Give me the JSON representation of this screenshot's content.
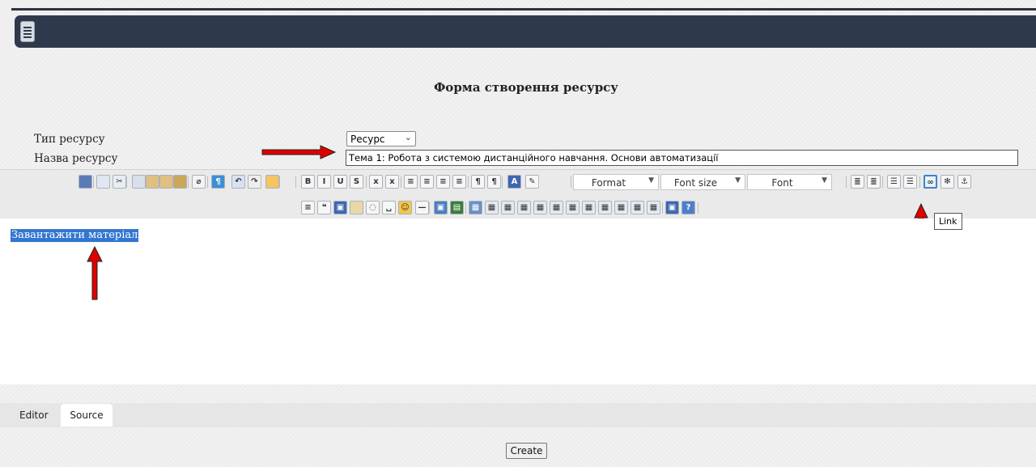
{
  "page": {
    "form_title": "Форма створення ресурсу"
  },
  "form": {
    "type_label": "Тип ресурсу",
    "type_value": "Ресурс",
    "name_label": "Назва ресурсу",
    "name_value": "Тема 1: Робота з системою дистанційного навчання. Основи автоматизації"
  },
  "toolbar": {
    "format_label": "Format",
    "font_size_label": "Font size",
    "font_label": "Font",
    "row1_icons": [
      "save-icon",
      "new-page-icon",
      "cut-icon",
      "copy-icon",
      "paste-icon",
      "paste-text-icon",
      "paste-word-icon",
      "remove-format-icon",
      "show-blocks-icon",
      "undo-icon",
      "redo-icon",
      "image-browser-icon",
      "bold-icon",
      "italic-icon",
      "underline-icon",
      "strike-icon",
      "subscript-icon",
      "superscript-icon",
      "align-left-icon",
      "align-center-icon",
      "align-right-icon",
      "justify-icon",
      "ltr-icon",
      "rtl-icon",
      "text-color-icon",
      "spellcheck-icon",
      "outdent-icon",
      "indent-icon",
      "numbered-list-icon",
      "bulleted-list-icon",
      "link-icon",
      "unlink-icon",
      "anchor-icon"
    ],
    "row2_icons": [
      "div-icon",
      "blockquote-icon",
      "maximize-icon",
      "template-icon",
      "flash-icon",
      "nbsp-icon",
      "smiley-icon",
      "horizontal-rule-icon",
      "image-icon",
      "media-icon",
      "table-icon",
      "table-props-icon",
      "delete-table-icon",
      "insert-row-icon",
      "delete-row-icon",
      "insert-col-icon",
      "delete-col-icon",
      "merge-cells-icon",
      "split-cells-icon",
      "cell-props-icon",
      "insert-cell-icon",
      "delete-cell-icon",
      "fullscreen-icon",
      "about-icon"
    ],
    "tooltip": "Link"
  },
  "editor": {
    "content_link_text": "Завантажити матеріал"
  },
  "tabs": {
    "editor_label": "Editor",
    "source_label": "Source"
  },
  "actions": {
    "create_label": "Create"
  },
  "colors": {
    "navbar": "#2e3a4c",
    "selection": "#3276d1",
    "arrow": "#e00000",
    "active_icon_border": "#3c82cf"
  }
}
